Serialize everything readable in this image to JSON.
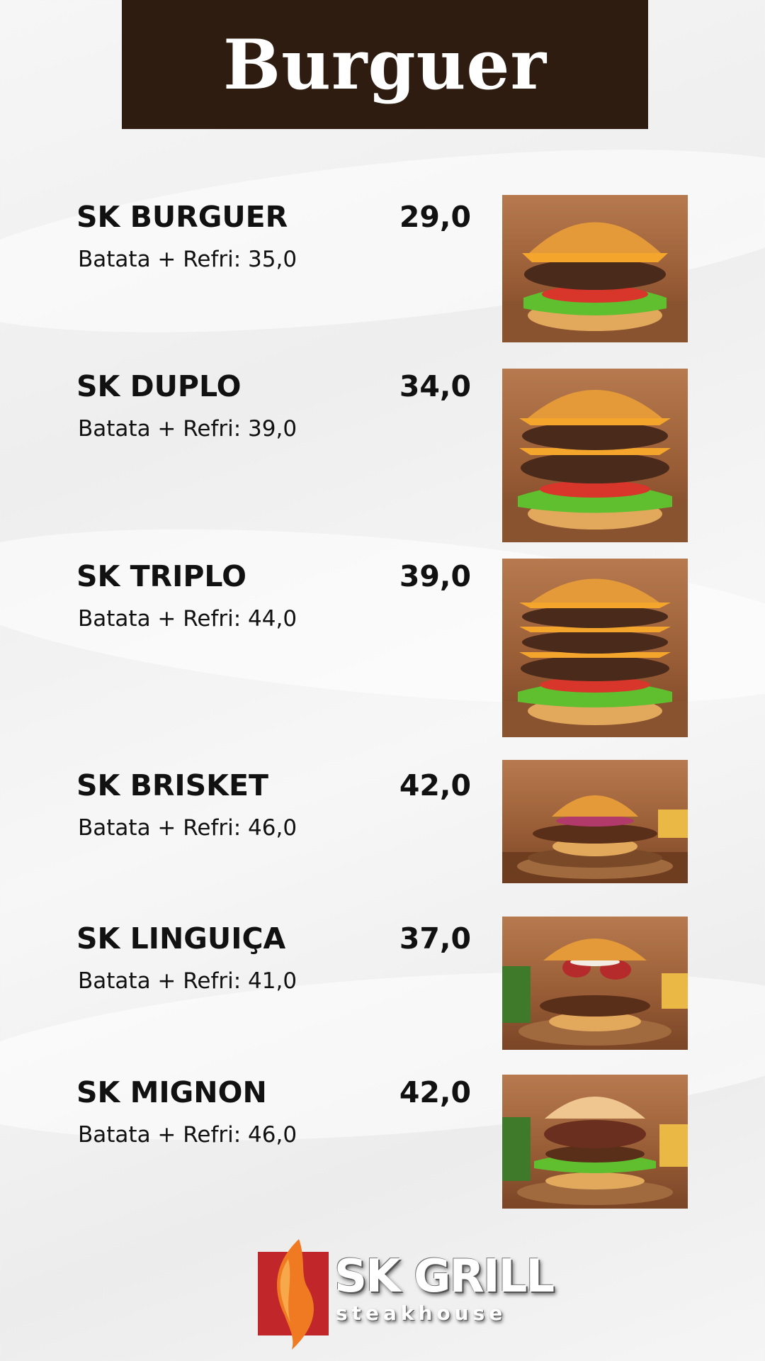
{
  "header": {
    "title": "Burguer"
  },
  "items": [
    {
      "name": "SK BURGUER",
      "price": "29,0",
      "combo": "Batata + Refri: 35,0",
      "image": "single-cheeseburger-photo"
    },
    {
      "name": "SK DUPLO",
      "price": "34,0",
      "combo": "Batata + Refri: 39,0",
      "image": "double-cheeseburger-photo"
    },
    {
      "name": "SK TRIPLO",
      "price": "39,0",
      "combo": "Batata + Refri: 44,0",
      "image": "triple-cheeseburger-photo"
    },
    {
      "name": "SK BRISKET",
      "price": "42,0",
      "combo": "Batata + Refri: 46,0",
      "image": "brisket-burger-photo"
    },
    {
      "name": "SK LINGUIÇA",
      "price": "37,0",
      "combo": "Batata + Refri: 41,0",
      "image": "sausage-burger-photo"
    },
    {
      "name": "SK MIGNON",
      "price": "42,0",
      "combo": "Batata + Refri: 46,0",
      "image": "mignon-burger-photo"
    }
  ],
  "logo": {
    "name": "SK GRILL",
    "subtitle": "steakhouse"
  },
  "colors": {
    "header_bg": "#2e1c10",
    "text": "#111111",
    "background": "#f2f2f2"
  }
}
